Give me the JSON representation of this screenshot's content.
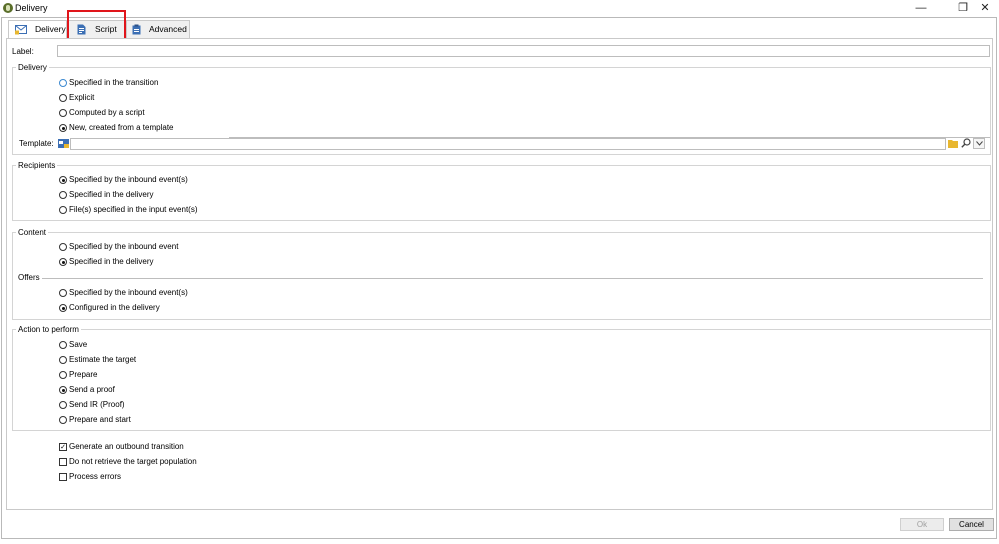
{
  "window": {
    "title": "Delivery",
    "minimize_glyph": "—",
    "restore_glyph": "❐",
    "close_glyph": "✕"
  },
  "tabs": [
    {
      "label": "Delivery",
      "icon": "envelope-icon",
      "active": true
    },
    {
      "label": "Script",
      "icon": "script-document-icon",
      "active": false
    },
    {
      "label": "Advanced",
      "icon": "clipboard-icon",
      "active": false
    }
  ],
  "label_field": {
    "label": "Label:",
    "value": ""
  },
  "delivery_group": {
    "title": "Delivery",
    "options": [
      {
        "label": "Specified in the transition",
        "selected": false
      },
      {
        "label": "Explicit",
        "selected": false
      },
      {
        "label": "Computed by a script",
        "selected": false
      },
      {
        "label": "New, created from a template",
        "selected": true
      }
    ],
    "template": {
      "label": "Template:",
      "value": ""
    }
  },
  "recipients_group": {
    "title": "Recipients",
    "options": [
      {
        "label": "Specified by the inbound event(s)",
        "selected": true
      },
      {
        "label": "Specified in the delivery",
        "selected": false
      },
      {
        "label": "File(s) specified in the input event(s)",
        "selected": false
      }
    ]
  },
  "content_group": {
    "title": "Content",
    "options": [
      {
        "label": "Specified by the inbound event",
        "selected": false
      },
      {
        "label": "Specified in the delivery",
        "selected": true
      }
    ]
  },
  "offers_group": {
    "title": "Offers",
    "options": [
      {
        "label": "Specified by the inbound event(s)",
        "selected": false
      },
      {
        "label": "Configured in the delivery",
        "selected": true
      }
    ]
  },
  "action_group": {
    "title": "Action to perform",
    "options": [
      {
        "label": "Save",
        "selected": false
      },
      {
        "label": "Estimate the target",
        "selected": false
      },
      {
        "label": "Prepare",
        "selected": false
      },
      {
        "label": "Send a proof",
        "selected": true
      },
      {
        "label": "Send IR (Proof)",
        "selected": false
      },
      {
        "label": "Prepare and start",
        "selected": false
      }
    ]
  },
  "checkboxes": [
    {
      "label": "Generate an outbound transition",
      "checked": true
    },
    {
      "label": "Do not retrieve the target population",
      "checked": false
    },
    {
      "label": "Process errors",
      "checked": false
    }
  ],
  "buttons": {
    "ok": "Ok",
    "cancel": "Cancel"
  },
  "colors": {
    "highlight": "#e0151b",
    "folder": "#e8b730",
    "accent_blue": "#3c89d0"
  }
}
